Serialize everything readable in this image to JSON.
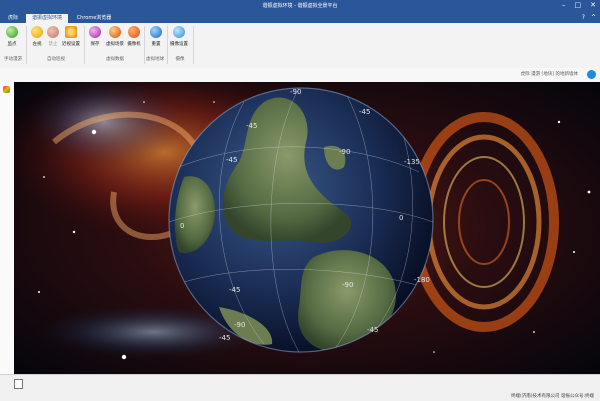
{
  "window": {
    "title": "谐振虚拟环境 - 谐振虚拟全景平台"
  },
  "tabs": [
    {
      "label": "虎际"
    },
    {
      "label": "谐振虚拟环境"
    },
    {
      "label": "Chrome浏览器"
    }
  ],
  "ribbon": {
    "buttons": [
      {
        "label": "监点"
      },
      {
        "label": "左视"
      },
      {
        "label": "禁止"
      },
      {
        "label": "近视设置"
      },
      {
        "label": "保存"
      },
      {
        "label": "虚拟场景"
      },
      {
        "label": "摄像机"
      },
      {
        "label": "重置"
      },
      {
        "label": "摄像设置"
      }
    ],
    "groups": [
      {
        "label": "手动漫游"
      },
      {
        "label": "自动巡视"
      },
      {
        "label": "虚拟数据"
      },
      {
        "label": "虚拟地球"
      },
      {
        "label": "摄像"
      }
    ]
  },
  "address": {
    "path": "虎际 漫游 [地块] 的地新墙体"
  },
  "globe": {
    "labels": [
      "-90",
      "-45",
      "-45",
      "-90",
      "-135",
      "-45",
      "0",
      "0",
      "-45",
      "-90",
      "-180",
      "-45",
      "-90",
      "-45"
    ]
  },
  "status": {
    "text": "终端(济南)技术有限公司  谐振公众号:终端"
  }
}
